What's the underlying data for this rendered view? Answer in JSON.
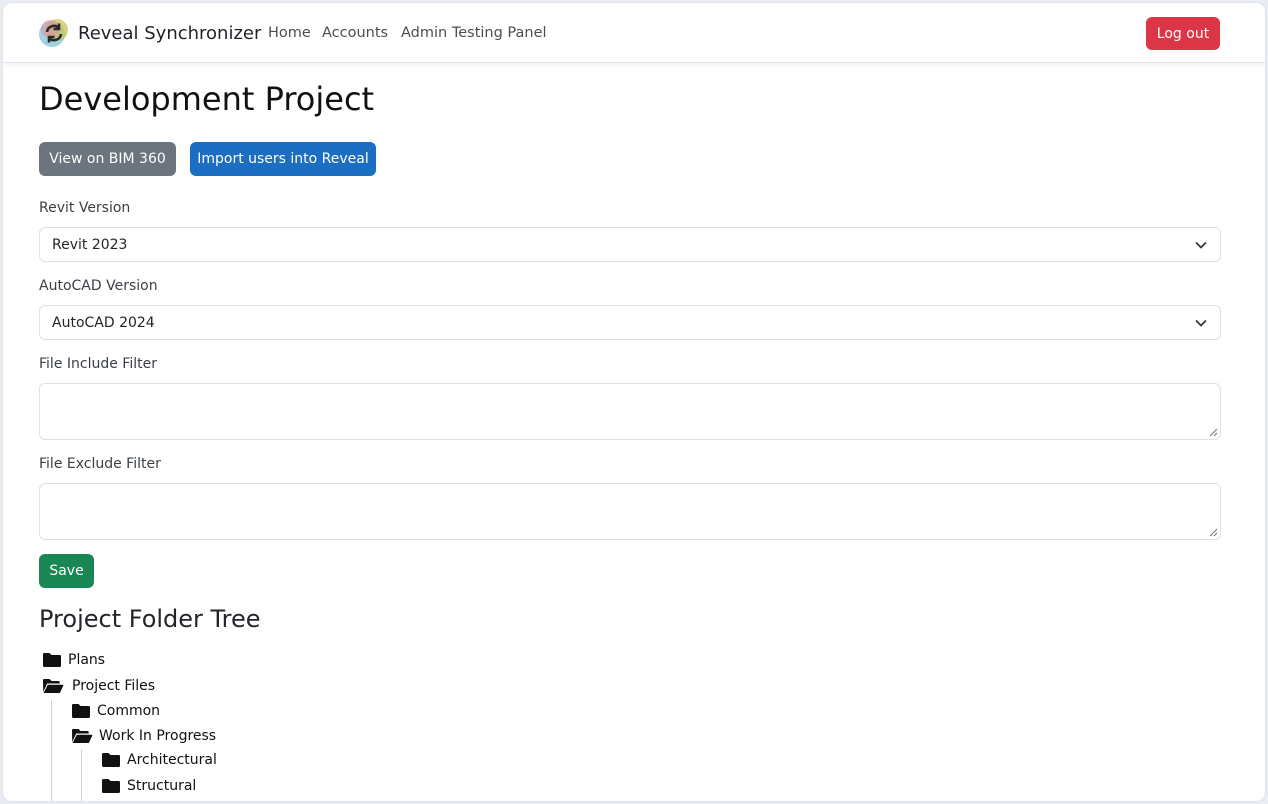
{
  "navbar": {
    "brand": "Reveal Synchronizer",
    "links": [
      "Home",
      "Accounts",
      "Admin Testing Panel"
    ],
    "logout_label": "Log out"
  },
  "page": {
    "title": "Development Project",
    "view_bim_label": "View on BIM 360",
    "import_users_label": "Import users into Reveal"
  },
  "form": {
    "revit_label": "Revit Version",
    "revit_value": "Revit 2023",
    "autocad_label": "AutoCAD Version",
    "autocad_value": "AutoCAD 2024",
    "include_label": "File Include Filter",
    "exclude_label": "File Exclude Filter",
    "save_label": "Save"
  },
  "tree": {
    "title": "Project Folder Tree",
    "items": [
      {
        "label": "Plans",
        "icon": "folder-closed-icon",
        "level": 0
      },
      {
        "label": "Project Files",
        "icon": "folder-open-icon",
        "level": 0
      },
      {
        "label": "Common",
        "icon": "folder-closed-icon",
        "level": 1
      },
      {
        "label": "Work In Progress",
        "icon": "folder-open-icon",
        "level": 1
      },
      {
        "label": "Architectural",
        "icon": "folder-closed-icon",
        "level": 2
      },
      {
        "label": "Structural",
        "icon": "folder-closed-icon",
        "level": 2
      }
    ]
  },
  "colors": {
    "danger": "#dc3545",
    "secondary": "#6c757d",
    "primary": "#1b6ec2",
    "success": "#198754"
  }
}
